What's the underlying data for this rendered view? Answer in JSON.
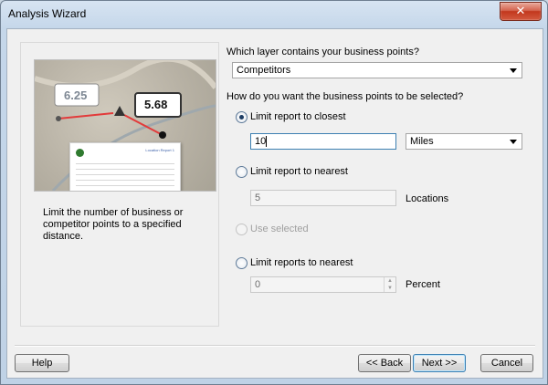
{
  "window": {
    "title": "Analysis Wizard",
    "close_glyph": "✕"
  },
  "left_panel": {
    "image": {
      "callout_left_value": "6.25",
      "callout_right_value": "5.68",
      "report_title": "Location Report 1"
    },
    "description": "Limit the number of business or competitor points to a specified distance."
  },
  "form": {
    "layer_question": "Which layer contains your business points?",
    "layer_selected": "Competitors",
    "selection_question": "How do you want the business points to be selected?",
    "options": [
      {
        "label": "Limit report to closest",
        "checked": true,
        "disabled": false
      },
      {
        "label": "Limit report to nearest",
        "checked": false,
        "disabled": false
      },
      {
        "label": "Use selected",
        "checked": false,
        "disabled": true
      },
      {
        "label": "Limit reports to nearest",
        "checked": false,
        "disabled": false
      }
    ],
    "closest_value": "10",
    "units_selected": "Miles",
    "nearest_value": "5",
    "nearest_unit_label": "Locations",
    "percent_value": "0",
    "percent_unit_label": "Percent"
  },
  "footer": {
    "help_label": "Help",
    "back_label": "<< Back",
    "next_label": "Next >>",
    "cancel_label": "Cancel"
  },
  "icons": {
    "close": "close-icon",
    "dropdown": "chevron-down-icon",
    "spinner_up": "spin-up-icon",
    "spinner_down": "spin-down-icon"
  }
}
